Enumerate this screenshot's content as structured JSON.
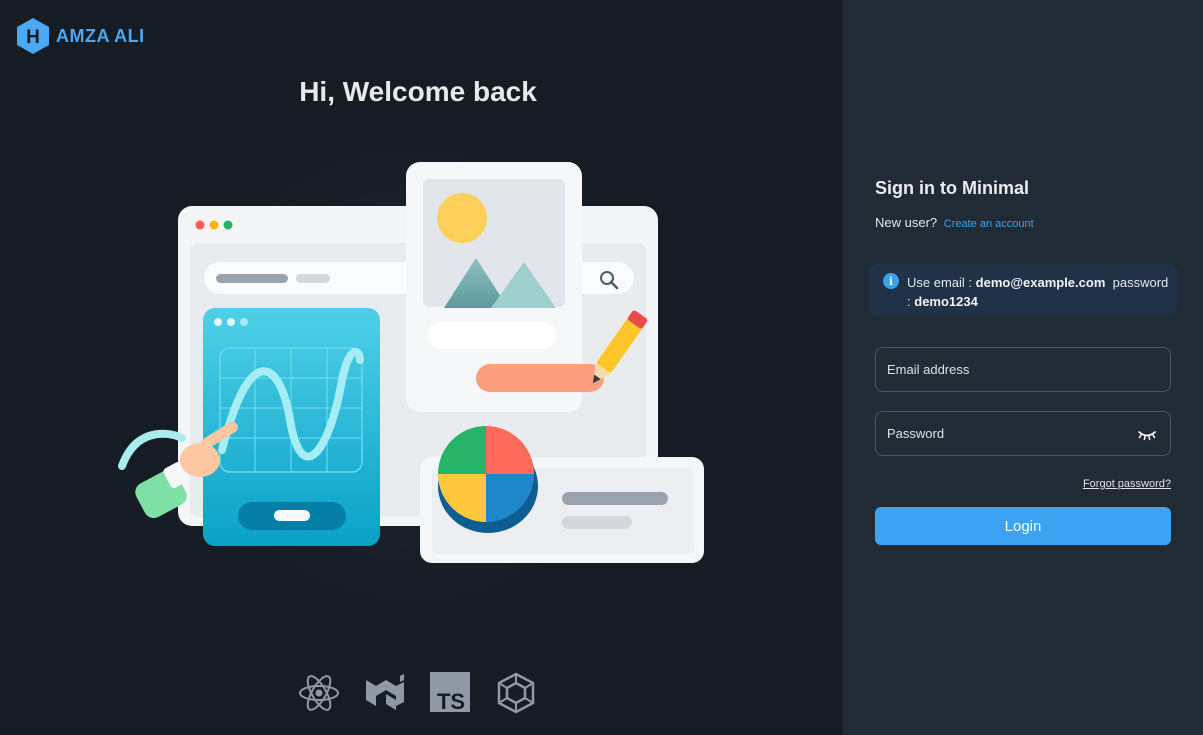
{
  "brand": {
    "letter": "H",
    "name": "AMZA ALI",
    "color": "#4aa8f5"
  },
  "hero": {
    "title": "Hi, Welcome back"
  },
  "tech_icons": [
    "react-icon",
    "mui-icon",
    "typescript-icon",
    "webpack-icon"
  ],
  "tech": {
    "ts_label": "TS"
  },
  "form": {
    "title": "Sign in to Minimal",
    "new_user_text": "New user?",
    "create_account_link": "Create an account",
    "alert": {
      "icon": "i",
      "prefix": "Use email :",
      "email": "demo@example.com",
      "password_label": "password :",
      "password": "demo1234"
    },
    "email_placeholder": "Email address",
    "password_placeholder": "Password",
    "forgot_link": "Forgot password?",
    "login_label": "Login"
  },
  "colors": {
    "left_bg": "#161c24",
    "right_bg": "#212b36",
    "accent": "#3ca3f2",
    "alert_bg": "#213147"
  }
}
